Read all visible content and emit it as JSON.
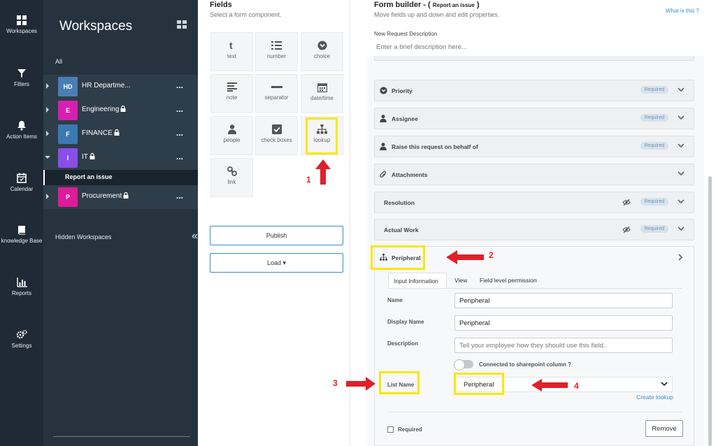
{
  "rail": {
    "items": [
      {
        "label": "Workspaces",
        "icon": "grid-icon"
      },
      {
        "label": "Filters",
        "icon": "filter-icon"
      },
      {
        "label": "Action Items",
        "icon": "bell-icon"
      },
      {
        "label": "Calendar",
        "icon": "calendar-icon"
      },
      {
        "label": "knowledge Base",
        "icon": "book-icon"
      },
      {
        "label": "Reports",
        "icon": "bar-chart-icon"
      },
      {
        "label": "Settings",
        "icon": "gears-icon"
      }
    ]
  },
  "workspaces": {
    "title": "Workspaces",
    "all_label": "All",
    "items": [
      {
        "initials": "HD",
        "name": "HR Departme...",
        "color": "#4a7fb5",
        "locked": false,
        "more": "..."
      },
      {
        "initials": "E",
        "name": "Engineering",
        "color": "#d81fb0",
        "locked": true,
        "more": "..."
      },
      {
        "initials": "F",
        "name": "FINANCE",
        "color": "#3a7ab0",
        "locked": true,
        "more": "..."
      },
      {
        "initials": "I",
        "name": "IT",
        "color": "#8a4ee8",
        "locked": true,
        "more": "..."
      },
      {
        "initials": "P",
        "name": "Procurement",
        "color": "#e01a9a",
        "locked": true,
        "more": "..."
      }
    ],
    "sub_item": "Report an issue",
    "hidden_label": "Hidden Workspaces",
    "collapse_glyph": "«"
  },
  "fields_panel": {
    "title": "Fields",
    "subtitle": "Select a form component.",
    "tiles": [
      "text",
      "number",
      "choice",
      "note",
      "separator",
      "date/time",
      "people",
      "check boxes",
      "lookup",
      "link"
    ],
    "publish_label": "Publish",
    "load_label": "Load ▾"
  },
  "annotations": [
    "1",
    "2",
    "3",
    "4"
  ],
  "form_builder": {
    "title": "Form builder - (",
    "title_context": "Report an issue",
    "title_close": ")",
    "subtitle": "Move fields up and down and edit properties.",
    "help_link": "What is this ?",
    "description_label": "New Request Description",
    "description_placeholder": "Enter a brief description here...",
    "required_badge": "Required",
    "fields": [
      {
        "label": "Priority",
        "icon": "choice-icon",
        "required": true,
        "hidden": false
      },
      {
        "label": "Assignee",
        "icon": "person-icon",
        "required": true,
        "hidden": false
      },
      {
        "label": "Raise this request on behalf of",
        "icon": "person-icon",
        "required": true,
        "hidden": false
      },
      {
        "label": "Attachments",
        "icon": "paperclip-icon",
        "required": false,
        "hidden": false
      },
      {
        "label": "Resolution",
        "icon": "",
        "required": true,
        "hidden": true
      },
      {
        "label": "Actual Work",
        "icon": "",
        "required": true,
        "hidden": true
      }
    ],
    "expanded": {
      "label": "Peripheral",
      "tabs": [
        "Input Information",
        "View",
        "Field level permission"
      ],
      "name_label": "Name",
      "name_value": "Peripheral",
      "display_name_label": "Display Name",
      "display_name_value": "Peripheral",
      "description_label": "Description",
      "description_placeholder": "Tell your employee how they should use this field..",
      "toggle_label": "Connected to sharepoint column ?",
      "list_name_label": "List Name",
      "list_name_value": "Peripheral",
      "create_lookup": "Create lookup",
      "required_label": "Required",
      "remove_label": "Remove"
    }
  }
}
